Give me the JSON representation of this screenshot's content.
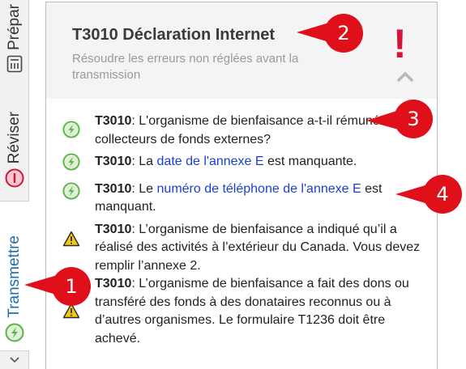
{
  "sidebar": {
    "tabs": [
      {
        "label": "Prépar",
        "icon": "calculator-icon"
      },
      {
        "label": "Réviser",
        "icon": "minus-circle-icon"
      },
      {
        "label": "Transmettre",
        "icon": "check-bolt-icon"
      }
    ]
  },
  "header": {
    "title": "T3010 Déclaration Internet",
    "subtitle": "Résoudre les erreurs non réglées avant la transmission",
    "alert_symbol": "!"
  },
  "items": [
    {
      "icon": "check-bolt-icon",
      "code": "T3010",
      "text": ": L'organisme de bienfaisance a-t-il rémunéré des collecteurs de fonds externes?"
    },
    {
      "icon": "check-bolt-icon",
      "code": "T3010",
      "pre": ": La ",
      "link": "date de l'annexe E",
      "post": " est manquante."
    },
    {
      "icon": "check-bolt-icon",
      "code": "T3010",
      "pre": ": Le ",
      "link": "numéro de téléphone de l'annexe E",
      "post": " est manquant."
    },
    {
      "icon": "warning-icon",
      "code": "T3010",
      "text": ": L’organisme de bienfaisance a indiqué qu’il a réalisé des activités à l’extérieur du Canada. Vous devez remplir l’annexe 2."
    },
    {
      "icon": "warning-icon",
      "code": "T3010",
      "text": ": L’organisme de bienfaisance a fait des dons ou transféré des fonds à des donataires reconnus ou à d’autres organismes. Le formulaire T1236 doit être achevé."
    }
  ],
  "callouts": [
    "1",
    "2",
    "3",
    "4"
  ],
  "colors": {
    "accent": "#1a6fb3",
    "alert": "#d3143d",
    "callout": "#e0101b",
    "link": "#1a3fd6",
    "success": "#59b24a",
    "warning": "#f0c419"
  }
}
